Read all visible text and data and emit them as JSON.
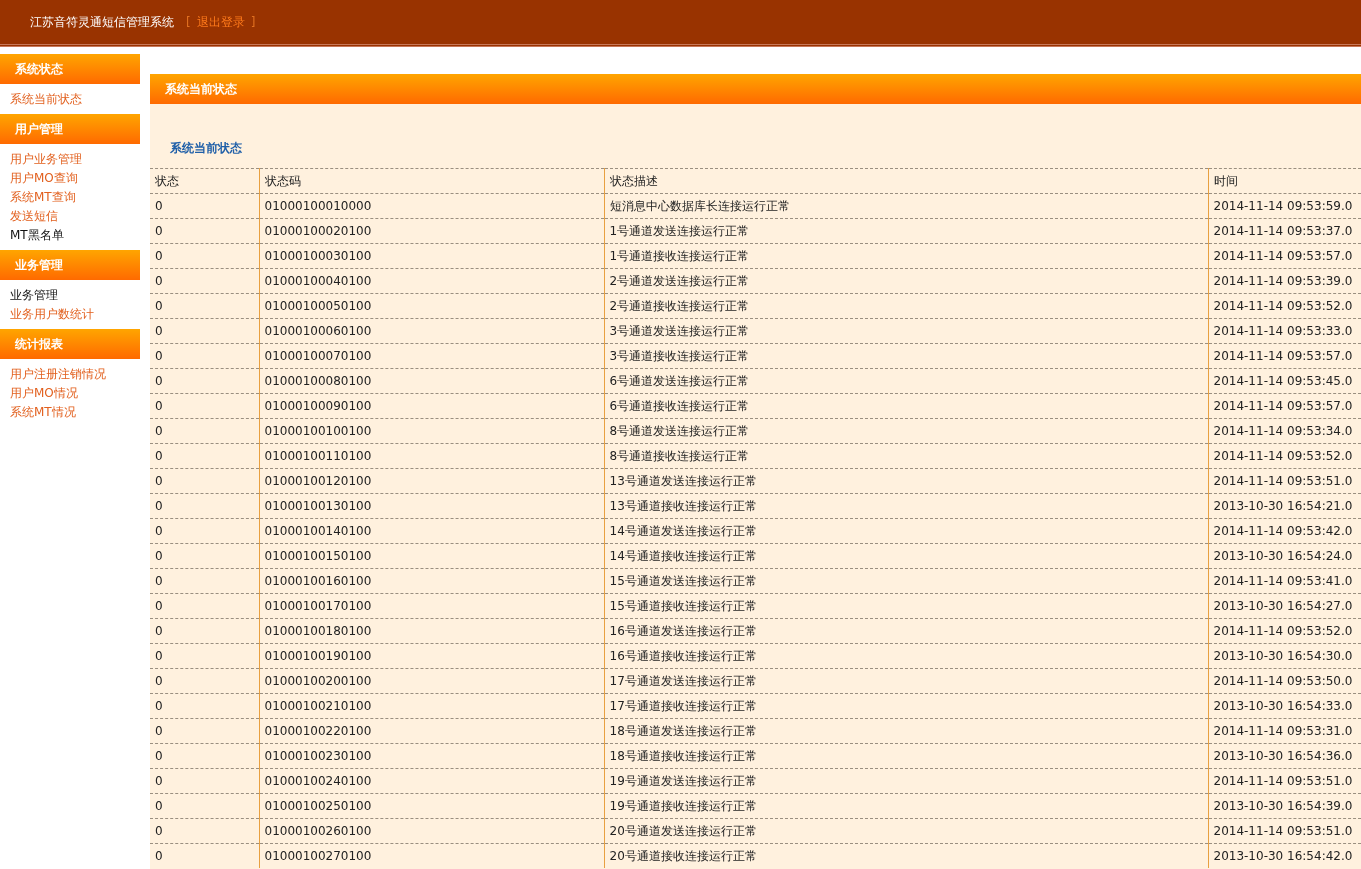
{
  "header": {
    "title": "江苏音符灵通短信管理系统",
    "open_bracket": "[",
    "logout_link": "退出登录",
    "close_bracket": "]"
  },
  "sidebar": [
    {
      "title": "系统状态",
      "items": [
        {
          "label": "系统当前状态",
          "visited": false
        }
      ]
    },
    {
      "title": "用户管理",
      "items": [
        {
          "label": "用户业务管理",
          "visited": false
        },
        {
          "label": "用户MO查询",
          "visited": false
        },
        {
          "label": "系统MT查询",
          "visited": false
        },
        {
          "label": "发送短信",
          "visited": false
        },
        {
          "label": "MT黑名单",
          "visited": true
        }
      ]
    },
    {
      "title": "业务管理",
      "items": [
        {
          "label": "业务管理",
          "visited": true
        },
        {
          "label": "业务用户数统计",
          "visited": false
        }
      ]
    },
    {
      "title": "统计报表",
      "items": [
        {
          "label": "用户注册注销情况",
          "visited": false
        },
        {
          "label": "用户MO情况",
          "visited": false
        },
        {
          "label": "系统MT情况",
          "visited": false
        }
      ]
    }
  ],
  "panel": {
    "title": "系统当前状态",
    "subtitle": "系统当前状态"
  },
  "table": {
    "columns": [
      "状态",
      "状态码",
      "状态描述",
      "时间"
    ],
    "rows": [
      [
        "0",
        "01000100010000",
        "短消息中心数据库长连接运行正常",
        "2014-11-14 09:53:59.0"
      ],
      [
        "0",
        "01000100020100",
        "1号通道发送连接运行正常",
        "2014-11-14 09:53:37.0"
      ],
      [
        "0",
        "01000100030100",
        "1号通道接收连接运行正常",
        "2014-11-14 09:53:57.0"
      ],
      [
        "0",
        "01000100040100",
        "2号通道发送连接运行正常",
        "2014-11-14 09:53:39.0"
      ],
      [
        "0",
        "01000100050100",
        "2号通道接收连接运行正常",
        "2014-11-14 09:53:52.0"
      ],
      [
        "0",
        "01000100060100",
        "3号通道发送连接运行正常",
        "2014-11-14 09:53:33.0"
      ],
      [
        "0",
        "01000100070100",
        "3号通道接收连接运行正常",
        "2014-11-14 09:53:57.0"
      ],
      [
        "0",
        "01000100080100",
        "6号通道发送连接运行正常",
        "2014-11-14 09:53:45.0"
      ],
      [
        "0",
        "01000100090100",
        "6号通道接收连接运行正常",
        "2014-11-14 09:53:57.0"
      ],
      [
        "0",
        "01000100100100",
        "8号通道发送连接运行正常",
        "2014-11-14 09:53:34.0"
      ],
      [
        "0",
        "01000100110100",
        "8号通道接收连接运行正常",
        "2014-11-14 09:53:52.0"
      ],
      [
        "0",
        "01000100120100",
        "13号通道发送连接运行正常",
        "2014-11-14 09:53:51.0"
      ],
      [
        "0",
        "01000100130100",
        "13号通道接收连接运行正常",
        "2013-10-30 16:54:21.0"
      ],
      [
        "0",
        "01000100140100",
        "14号通道发送连接运行正常",
        "2014-11-14 09:53:42.0"
      ],
      [
        "0",
        "01000100150100",
        "14号通道接收连接运行正常",
        "2013-10-30 16:54:24.0"
      ],
      [
        "0",
        "01000100160100",
        "15号通道发送连接运行正常",
        "2014-11-14 09:53:41.0"
      ],
      [
        "0",
        "01000100170100",
        "15号通道接收连接运行正常",
        "2013-10-30 16:54:27.0"
      ],
      [
        "0",
        "01000100180100",
        "16号通道发送连接运行正常",
        "2014-11-14 09:53:52.0"
      ],
      [
        "0",
        "01000100190100",
        "16号通道接收连接运行正常",
        "2013-10-30 16:54:30.0"
      ],
      [
        "0",
        "01000100200100",
        "17号通道发送连接运行正常",
        "2014-11-14 09:53:50.0"
      ],
      [
        "0",
        "01000100210100",
        "17号通道接收连接运行正常",
        "2013-10-30 16:54:33.0"
      ],
      [
        "0",
        "01000100220100",
        "18号通道发送连接运行正常",
        "2014-11-14 09:53:31.0"
      ],
      [
        "0",
        "01000100230100",
        "18号通道接收连接运行正常",
        "2013-10-30 16:54:36.0"
      ],
      [
        "0",
        "01000100240100",
        "19号通道发送连接运行正常",
        "2014-11-14 09:53:51.0"
      ],
      [
        "0",
        "01000100250100",
        "19号通道接收连接运行正常",
        "2013-10-30 16:54:39.0"
      ],
      [
        "0",
        "01000100260100",
        "20号通道发送连接运行正常",
        "2014-11-14 09:53:51.0"
      ],
      [
        "0",
        "01000100270100",
        "20号通道接收连接运行正常",
        "2013-10-30 16:54:42.0"
      ]
    ]
  }
}
